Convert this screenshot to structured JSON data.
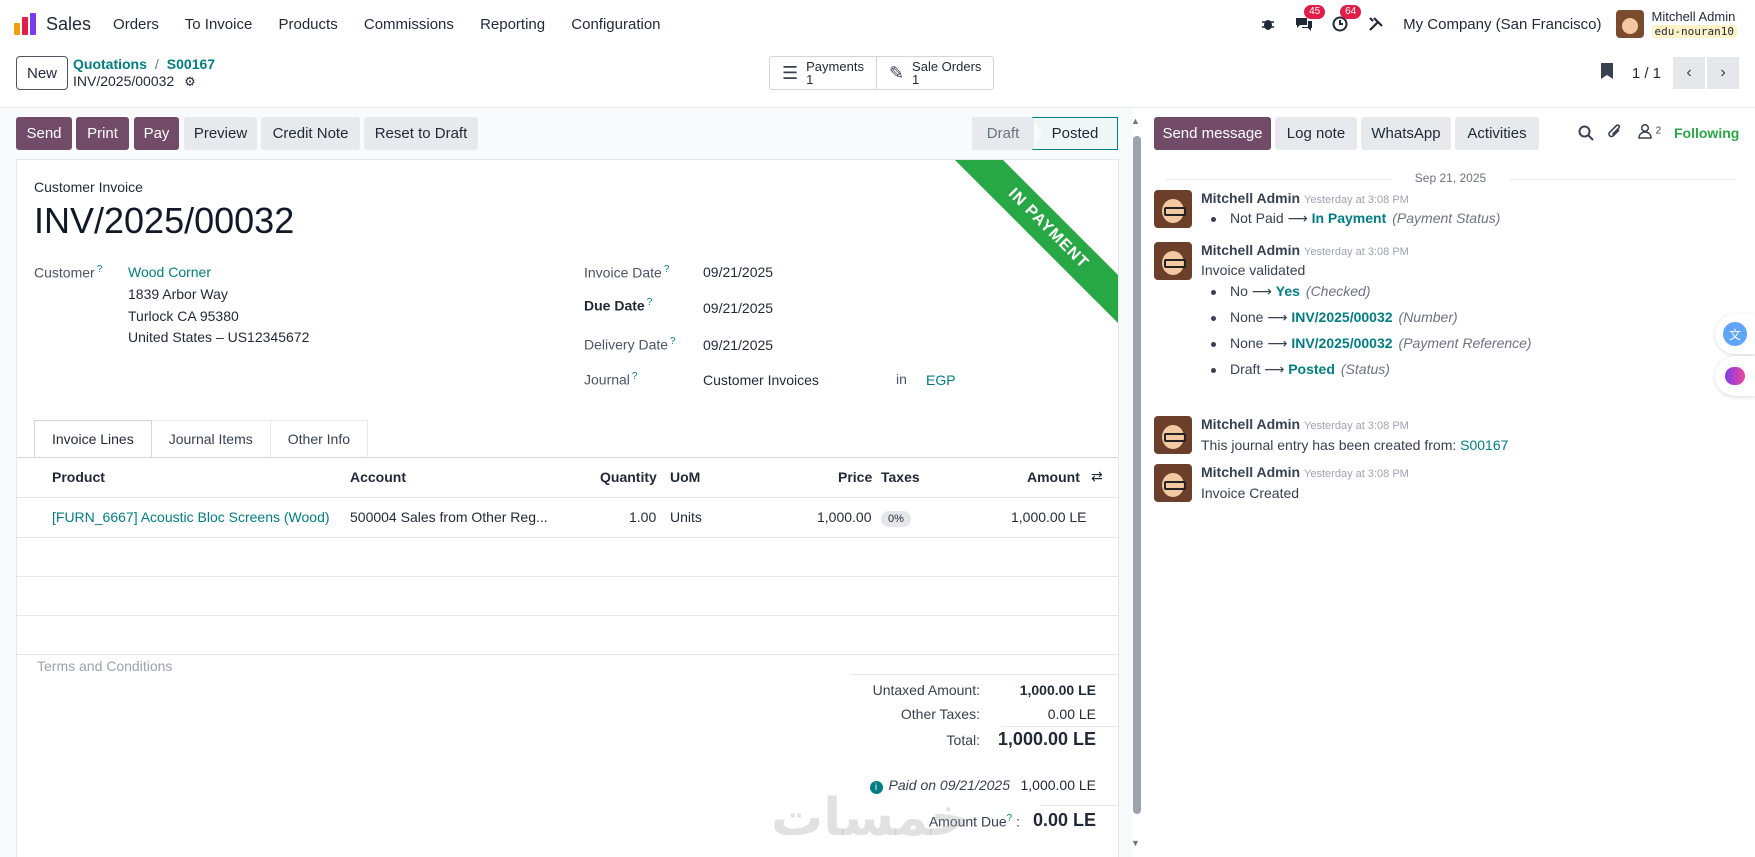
{
  "nav": {
    "app": "Sales",
    "menu": [
      "Orders",
      "To Invoice",
      "Products",
      "Commissions",
      "Reporting",
      "Configuration"
    ],
    "messages_badge": "45",
    "activities_badge": "64",
    "company": "My Company (San Francisco)",
    "user": "Mitchell Admin",
    "db": "edu-nouran10"
  },
  "control": {
    "new": "New",
    "crumb1": "Quotations",
    "crumb2": "S00167",
    "current": "INV/2025/00032",
    "smart": [
      {
        "label": "Payments",
        "count": "1"
      },
      {
        "label": "Sale Orders",
        "count": "1"
      }
    ],
    "pager": "1 / 1"
  },
  "header_buttons": [
    "Send",
    "Print",
    "Pay",
    "Preview",
    "Credit Note",
    "Reset to Draft"
  ],
  "status": {
    "draft": "Draft",
    "posted": "Posted"
  },
  "sheet": {
    "ribbon": "IN PAYMENT",
    "doc_type": "Customer Invoice",
    "name": "INV/2025/00032",
    "customer_label": "Customer",
    "customer": "Wood Corner",
    "address1": "1839 Arbor Way",
    "address2": "Turlock CA 95380",
    "address3": "United States – US12345672",
    "invoice_date_label": "Invoice Date",
    "invoice_date": "09/21/2025",
    "due_date_label": "Due Date",
    "due_date": "09/21/2025",
    "delivery_date_label": "Delivery Date",
    "delivery_date": "09/21/2025",
    "journal_label": "Journal",
    "journal": "Customer Invoices",
    "in": "in",
    "currency": "EGP",
    "help": "?"
  },
  "tabs": [
    "Invoice Lines",
    "Journal Items",
    "Other Info"
  ],
  "lines": {
    "headers": {
      "product": "Product",
      "account": "Account",
      "quantity": "Quantity",
      "uom": "UoM",
      "price": "Price",
      "taxes": "Taxes",
      "amount": "Amount"
    },
    "rows": [
      {
        "product": "[FURN_6667] Acoustic Bloc Screens (Wood)",
        "account": "500004 Sales from Other Reg...",
        "quantity": "1.00",
        "uom": "Units",
        "price": "1,000.00",
        "taxes": "0%",
        "amount": "1,000.00 LE"
      }
    ]
  },
  "terms_placeholder": "Terms and Conditions",
  "totals": {
    "untaxed_label": "Untaxed Amount:",
    "untaxed": "1,000.00 LE",
    "other_label": "Other Taxes:",
    "other": "0.00 LE",
    "total_label": "Total:",
    "total": "1,000.00 LE",
    "paid_label": "Paid on 09/21/2025",
    "paid": "1,000.00 LE",
    "due_label": "Amount Due",
    "due_colon": ":",
    "due": "0.00 LE"
  },
  "chatter": {
    "send_message": "Send message",
    "log_note": "Log note",
    "whatsapp": "WhatsApp",
    "activities": "Activities",
    "followers_count": "2",
    "following": "Following",
    "date": "Sep 21, 2025",
    "messages": [
      {
        "author": "Mitchell Admin",
        "time": "Yesterday at 3:08 PM"
      },
      {
        "author": "Mitchell Admin",
        "time": "Yesterday at 3:08 PM",
        "body": "Invoice validated"
      },
      {
        "author": "Mitchell Admin",
        "time": "Yesterday at 3:08 PM",
        "body": "This journal entry has been created from:",
        "link": "S00167"
      },
      {
        "author": "Mitchell Admin",
        "time": "Yesterday at 3:08 PM",
        "body": "Invoice Created"
      }
    ],
    "tracking": [
      {
        "old": "Not Paid",
        "new": "In Payment",
        "field": "(Payment Status)"
      },
      {
        "old": "No",
        "new": "Yes",
        "field": "(Checked)"
      },
      {
        "old": "None",
        "new": "INV/2025/00032",
        "field": "(Number)"
      },
      {
        "old": "None",
        "new": "INV/2025/00032",
        "field": "(Payment Reference)"
      },
      {
        "old": "Draft",
        "new": "Posted",
        "field": "(Status)"
      }
    ]
  },
  "watermark": "خمسات",
  "colors": {
    "brand": "#714b67",
    "link": "#017e84",
    "ribbon": "#28a745"
  }
}
